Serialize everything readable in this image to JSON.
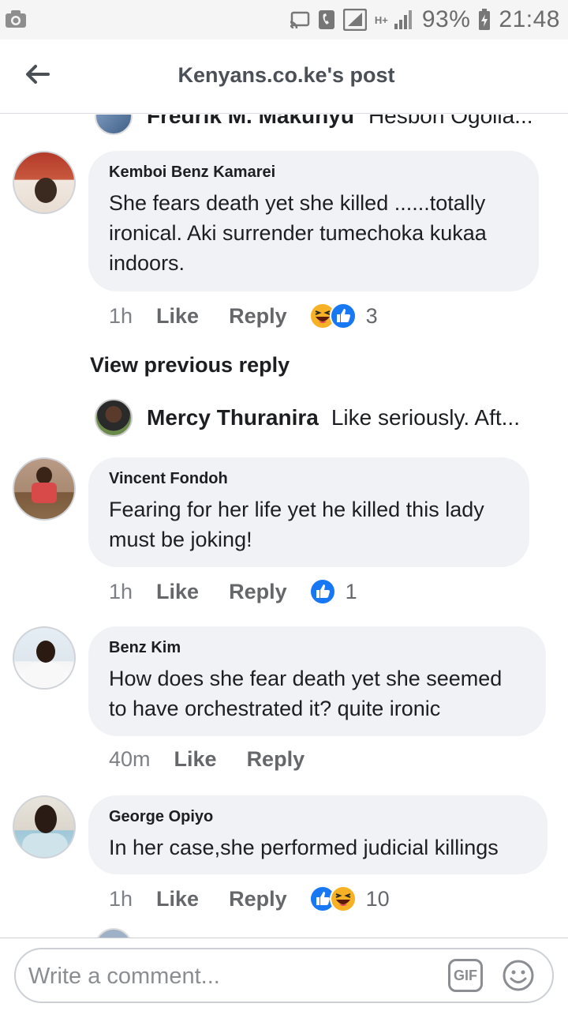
{
  "status_bar": {
    "battery_pct": "93%",
    "time": "21:48",
    "network": "H+",
    "icons": [
      "camera-icon",
      "cast-icon",
      "phone-icon",
      "signal-icon",
      "battery-icon"
    ]
  },
  "header": {
    "title": "Kenyans.co.ke's post",
    "back_icon": "arrow-left-icon"
  },
  "peek_reply": {
    "name": "Fredrik M. Makunyu",
    "text": "Hesbon Ogolla..."
  },
  "comments": [
    {
      "author": "Kemboi Benz Kamarei",
      "body_lines": [
        "She fears death yet she killed ......totally",
        "ironical. Aki surrender tumechoka kukaa",
        "indoors."
      ],
      "time": "1h",
      "like": "Like",
      "reply": "Reply",
      "reactions": [
        "haha",
        "like"
      ],
      "reaction_count": "3"
    },
    {
      "author": "Vincent Fondoh",
      "body_lines": [
        "Fearing for her life yet he killed this lady",
        "must be joking!"
      ],
      "time": "1h",
      "like": "Like",
      "reply": "Reply",
      "reactions": [
        "like"
      ],
      "reaction_count": "1"
    },
    {
      "author": "Benz Kim",
      "body_lines": [
        "How does she fear death yet she seemed",
        "to have orchestrated it? quite ironic"
      ],
      "time": "40m",
      "like": "Like",
      "reply": "Reply",
      "reactions": [],
      "reaction_count": ""
    },
    {
      "author": "George Opiyo",
      "body_lines": [
        "In her case,she performed judicial killings"
      ],
      "time": "1h",
      "like": "Like",
      "reply": "Reply",
      "reactions": [
        "like",
        "haha"
      ],
      "reaction_count": "10"
    }
  ],
  "view_previous": "View previous reply",
  "reply_preview": {
    "name": "Mercy Thuranira",
    "text": "Like seriously. Aft..."
  },
  "composer": {
    "placeholder": "Write a comment...",
    "gif_label": "GIF",
    "emoji_icon": "smiley-icon"
  },
  "colors": {
    "bubble": "#f0f2f5",
    "like_blue": "#1877f2",
    "haha_yellow": "#f7b125",
    "muted": "#65676b"
  }
}
